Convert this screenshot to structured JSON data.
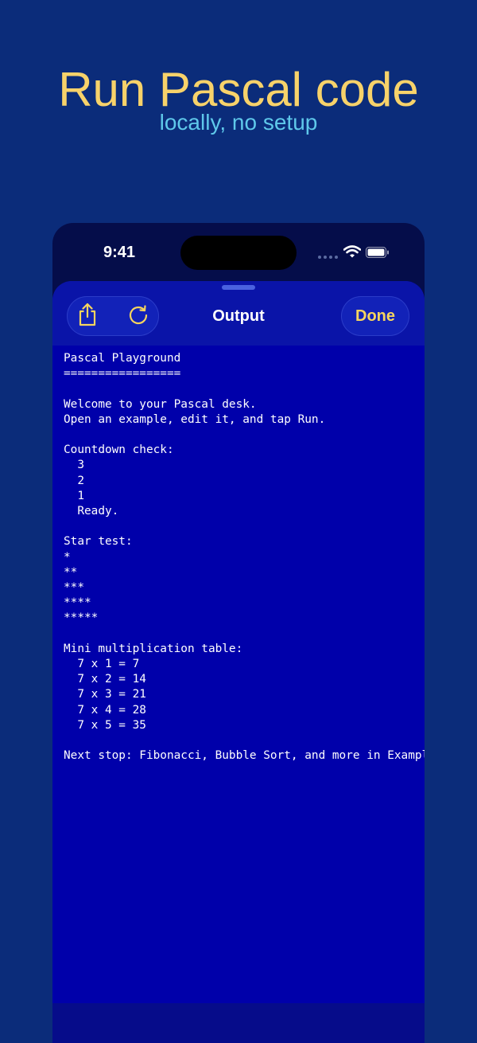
{
  "hero": {
    "title": "Run Pascal code",
    "subtitle": "locally, no setup"
  },
  "status_bar": {
    "time": "9:41"
  },
  "toolbar": {
    "title": "Output",
    "done_label": "Done"
  },
  "output": {
    "lines": [
      "Pascal Playground",
      "=================",
      "",
      "Welcome to your Pascal desk.",
      "Open an example, edit it, and tap Run.",
      "",
      "Countdown check:",
      "  3",
      "  2",
      "  1",
      "  Ready.",
      "",
      "Star test:",
      "*",
      "**",
      "***",
      "****",
      "*****",
      "",
      "Mini multiplication table:",
      "  7 x 1 = 7",
      "  7 x 2 = 14",
      "  7 x 3 = 21",
      "  7 x 4 = 28",
      "  7 x 5 = 35",
      "",
      "Next stop: Fibonacci, Bubble Sort, and more in Examples."
    ]
  },
  "icons": {
    "share": "share-icon",
    "reload": "reload-icon",
    "wifi": "wifi-icon",
    "battery": "battery-icon"
  },
  "colors": {
    "background": "#0b2c7a",
    "title": "#f7d26a",
    "subtitle": "#5fc8ea",
    "accent": "#f6d55e",
    "terminal": "#0000aa"
  }
}
